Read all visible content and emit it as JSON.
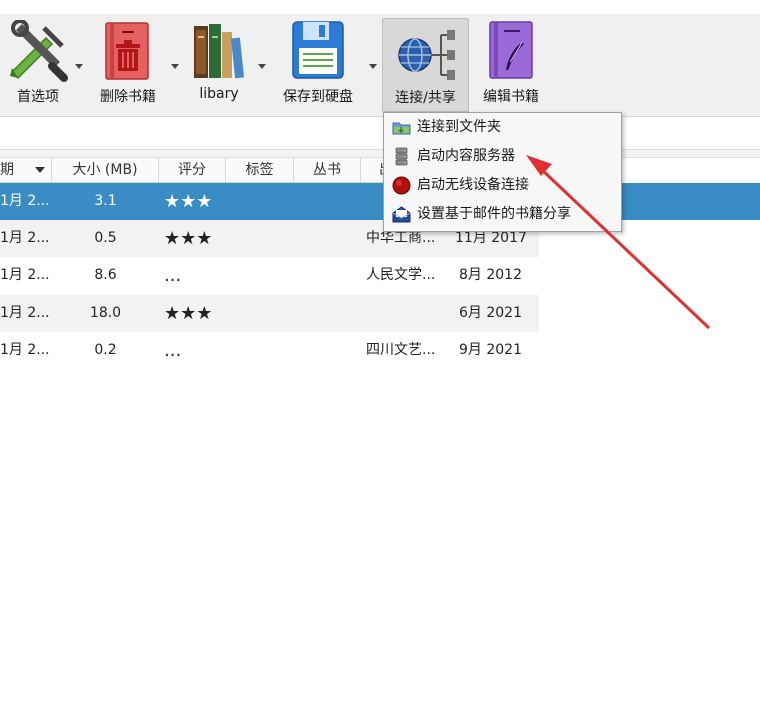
{
  "toolbar": {
    "buttons": [
      {
        "label": "首选项"
      },
      {
        "label": "删除书籍"
      },
      {
        "label": "libary"
      },
      {
        "label": "保存到硬盘"
      },
      {
        "label": "连接/共享"
      },
      {
        "label": "编辑书籍"
      }
    ]
  },
  "table": {
    "columns": [
      "期",
      "大小 (MB)",
      "评分",
      "标签",
      "丛书",
      "出"
    ],
    "rows": [
      {
        "date": "1月 2...",
        "size": "3.1",
        "rating": "★★★",
        "publisher": "",
        "pubdate": ""
      },
      {
        "date": "1月 2...",
        "size": "0.5",
        "rating": "★★★",
        "publisher": "中华工商...",
        "pubdate": "11月 2017"
      },
      {
        "date": "1月 2...",
        "size": "8.6",
        "rating": "...",
        "publisher": "人民文学...",
        "pubdate": "8月 2012"
      },
      {
        "date": "1月 2...",
        "size": "18.0",
        "rating": "★★★",
        "publisher": "",
        "pubdate": "6月 2021"
      },
      {
        "date": "1月 2...",
        "size": "0.2",
        "rating": "...",
        "publisher": "四川文艺...",
        "pubdate": "9月 2021"
      }
    ]
  },
  "menu": {
    "items": [
      {
        "label": "连接到文件夹",
        "icon": "folder-icon"
      },
      {
        "label": "启动内容服务器",
        "icon": "server-icon"
      },
      {
        "label": "启动无线设备连接",
        "icon": "record-icon"
      },
      {
        "label": "设置基于邮件的书籍分享",
        "icon": "mail-icon"
      }
    ]
  },
  "colors": {
    "selection": "#3a8cc4",
    "annotation_arrow": "#e03030"
  }
}
